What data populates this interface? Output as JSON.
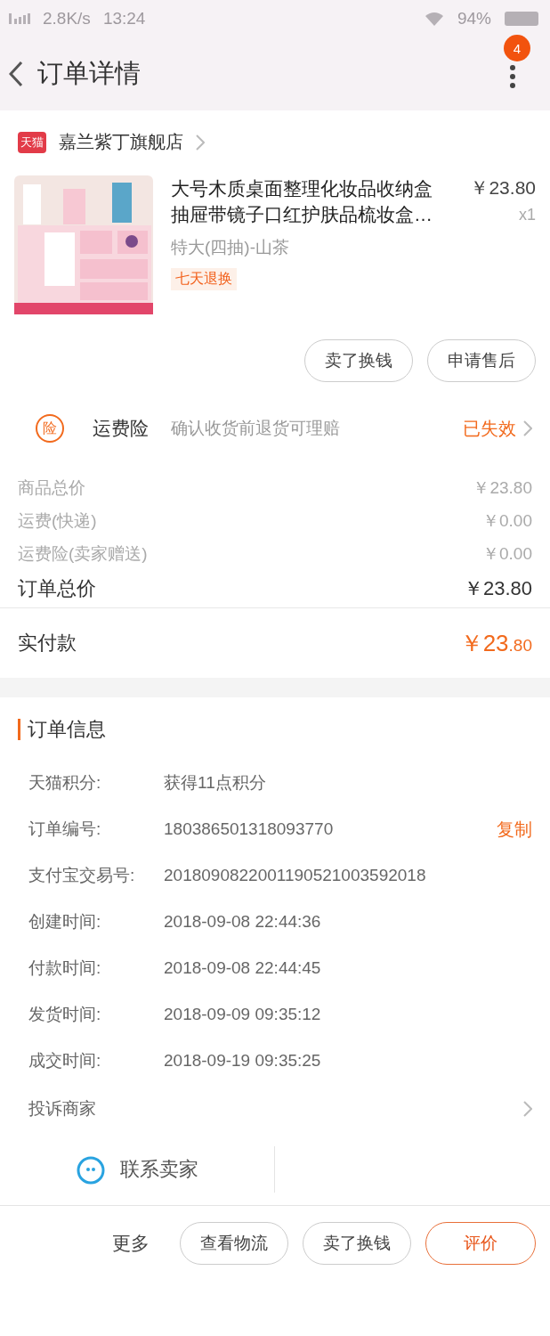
{
  "status_bar": {
    "network_speed": "2.8K/s",
    "time": "13:24",
    "battery": "94%"
  },
  "header": {
    "title": "订单详情",
    "badge": "4"
  },
  "store": {
    "logo_text": "天猫",
    "name": "嘉兰紫丁旗舰店"
  },
  "product": {
    "title": "大号木质桌面整理化妆品收纳盒抽屉带镜子口红护肤品梳妆盒…",
    "price": "￥23.80",
    "quantity": "x1",
    "spec": "特大(四抽)-山茶",
    "tag": "七天退换"
  },
  "product_actions": [
    "卖了换钱",
    "申请售后"
  ],
  "insurance": {
    "icon": "险",
    "label": "运费险",
    "description": "确认收货前退货可理赔",
    "status": "已失效"
  },
  "price_rows": [
    {
      "label": "商品总价",
      "value": "￥23.80",
      "kind": "minor"
    },
    {
      "label": "运费(快递)",
      "value": "￥0.00",
      "kind": "minor"
    },
    {
      "label": "运费险(卖家赠送)",
      "value": "￥0.00",
      "kind": "minor"
    },
    {
      "label": "订单总价",
      "value": "￥23.80",
      "kind": "total"
    }
  ],
  "paid": {
    "label": "实付款",
    "amount_main": "￥23",
    "amount_decimal": ".80"
  },
  "order_info": {
    "title": "订单信息",
    "rows": [
      {
        "label": "天猫积分:",
        "value": "获得11点积分"
      },
      {
        "label": "订单编号:",
        "value": "180386501318093770",
        "action": "复制"
      },
      {
        "label": "支付宝交易号:",
        "value": "2018090822001190521003592018"
      },
      {
        "label": "创建时间:",
        "value": "2018-09-08 22:44:36"
      },
      {
        "label": "付款时间:",
        "value": "2018-09-08 22:44:45"
      },
      {
        "label": "发货时间:",
        "value": "2018-09-09 09:35:12"
      },
      {
        "label": "成交时间:",
        "value": "2018-09-19 09:35:25"
      }
    ],
    "complaint": "投诉商家"
  },
  "contact": {
    "label": "联系卖家"
  },
  "bottom_bar": {
    "more": "更多",
    "buttons": [
      {
        "label": "查看物流",
        "kind": "plain"
      },
      {
        "label": "卖了换钱",
        "kind": "plain"
      },
      {
        "label": "评价",
        "kind": "primary"
      }
    ]
  }
}
